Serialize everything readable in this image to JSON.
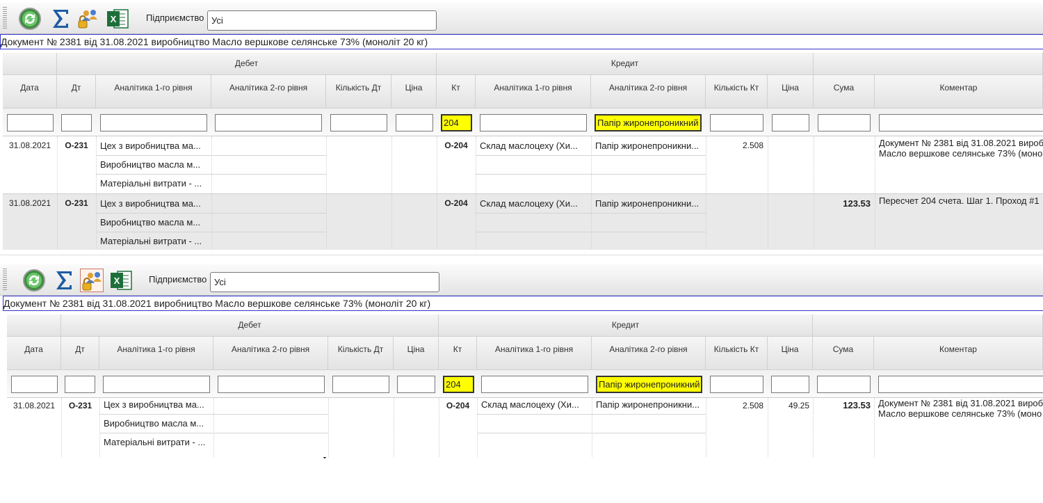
{
  "toolbar": {
    "enterprise_label": "Підприємство",
    "enterprise_value": "Усі"
  },
  "document_title": "Документ № 2381 від 31.08.2021 виробництво Масло вершкове селянське 73% (моноліт 20 кг)",
  "table": {
    "group_debit": "Дебет",
    "group_credit": "Кредит",
    "columns": {
      "date": "Дата",
      "dt": "Дт",
      "an1_dt": "Аналітика 1-го рівня",
      "an2_dt": "Аналітика 2-го рівня",
      "qty_dt": "Кількість Дт",
      "price_dt": "Ціна",
      "kt": "Кт",
      "an1_kt": "Аналітика 1-го рівня",
      "an2_kt": "Аналітика 2-го рівня",
      "qty_kt": "Кількість Кт",
      "price_kt": "Ціна",
      "sum": "Сума",
      "comment": "Коментар"
    },
    "filters": {
      "kt": "204",
      "an2_kt": "Папір жиронепроникний"
    }
  },
  "panel1": {
    "rows": [
      {
        "date": "31.08.2021",
        "dt": "О-231",
        "dt_analytics": [
          "Цех з виробництва ма...",
          "Виробництво масла м...",
          "Матеріальні витрати - ..."
        ],
        "kt": "О-204",
        "kt_an1": "Склад маслоцеху (Хи...",
        "kt_an2": "Папір жиронепроникни...",
        "qty_kt": "2.508",
        "price_kt": "",
        "sum": "",
        "comment_1": "Документ № 2381 від 31.08.2021 вироб",
        "comment_2": "Масло вершкове селянське 73% (моно"
      },
      {
        "date": "31.08.2021",
        "dt": "О-231",
        "dt_analytics": [
          "Цех з виробництва ма...",
          "Виробництво масла м...",
          "Матеріальні витрати - ..."
        ],
        "kt": "О-204",
        "kt_an1": "Склад маслоцеху (Хи...",
        "kt_an2": "Папір жиронепроникни...",
        "qty_kt": "",
        "price_kt": "",
        "sum": "123.53",
        "comment_1": "Пересчет 204 счета. Шаг 1. Проход #1",
        "comment_2": ""
      }
    ]
  },
  "panel2": {
    "rows": [
      {
        "date": "31.08.2021",
        "dt": "О-231",
        "dt_analytics": [
          "Цех з виробництва ма...",
          "Виробництво масла м...",
          "Матеріальні витрати - ..."
        ],
        "kt": "О-204",
        "kt_an1": "Склад маслоцеху (Хи...",
        "kt_an2": "Папір жиронепроникни...",
        "qty_kt": "2.508",
        "price_kt": "49.25",
        "sum": "123.53",
        "comment_1": "Документ № 2381 від 31.08.2021 вироб",
        "comment_2": "Масло вершкове селянське 73% (моно"
      }
    ]
  },
  "icons": [
    "refresh-icon",
    "sum-icon",
    "users-lock-icon",
    "excel-icon",
    "chevron-down-icon"
  ]
}
